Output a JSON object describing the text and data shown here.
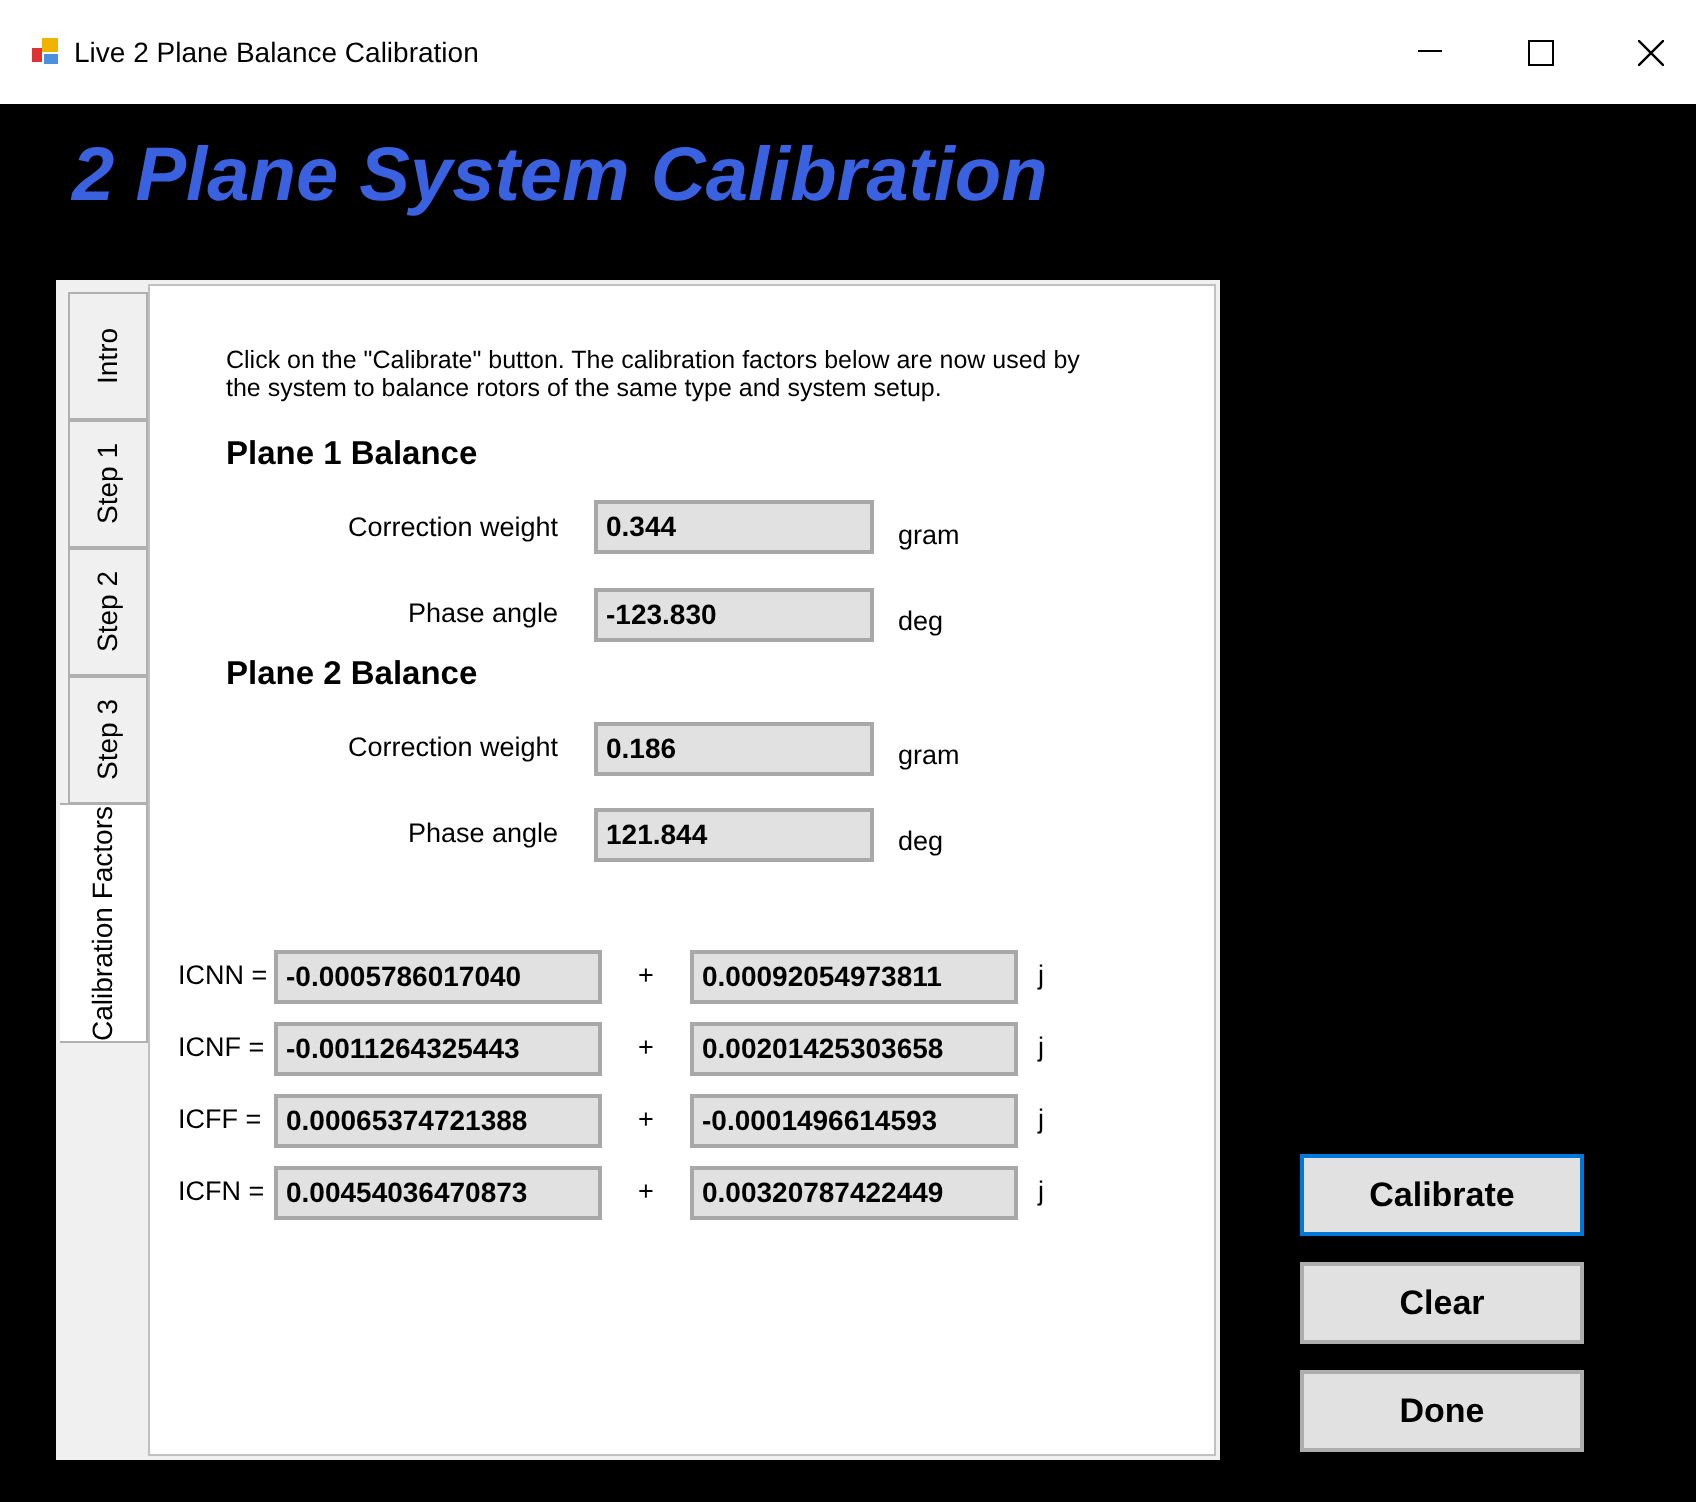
{
  "window": {
    "title": "Live 2 Plane Balance Calibration"
  },
  "heading": "2 Plane System Calibration",
  "tabs": [
    {
      "label": "Intro",
      "selected": false
    },
    {
      "label": "Step 1",
      "selected": false
    },
    {
      "label": "Step 2",
      "selected": false
    },
    {
      "label": "Step 3",
      "selected": false
    },
    {
      "label": "Calibration Factors",
      "selected": true
    }
  ],
  "instructions": "Click on the \"Calibrate\" button. The calibration factors below are now used by the system to balance rotors of the same type and system setup.",
  "planes": [
    {
      "title": "Plane 1 Balance",
      "fields": [
        {
          "label": "Correction weight",
          "value": "0.344",
          "unit": "gram"
        },
        {
          "label": "Phase angle",
          "value": "-123.830",
          "unit": "deg"
        }
      ]
    },
    {
      "title": "Plane 2 Balance",
      "fields": [
        {
          "label": "Correction weight",
          "value": "0.186",
          "unit": "gram"
        },
        {
          "label": "Phase angle",
          "value": "121.844",
          "unit": "deg"
        }
      ]
    }
  ],
  "factors": [
    {
      "label": "ICNN =",
      "real": "-0.0005786017040",
      "plus": "+",
      "imag": "0.00092054973811",
      "j": "j"
    },
    {
      "label": "ICNF =",
      "real": "-0.0011264325443",
      "plus": "+",
      "imag": "0.00201425303658",
      "j": "j"
    },
    {
      "label": "ICFF =",
      "real": "0.00065374721388",
      "plus": "+",
      "imag": "-0.0001496614593",
      "j": "j"
    },
    {
      "label": "ICFN =",
      "real": "0.00454036470873",
      "plus": "+",
      "imag": "0.00320787422449",
      "j": "j"
    }
  ],
  "buttons": [
    {
      "label": "Calibrate",
      "focused": true
    },
    {
      "label": "Clear",
      "focused": false
    },
    {
      "label": "Done",
      "focused": false
    }
  ]
}
